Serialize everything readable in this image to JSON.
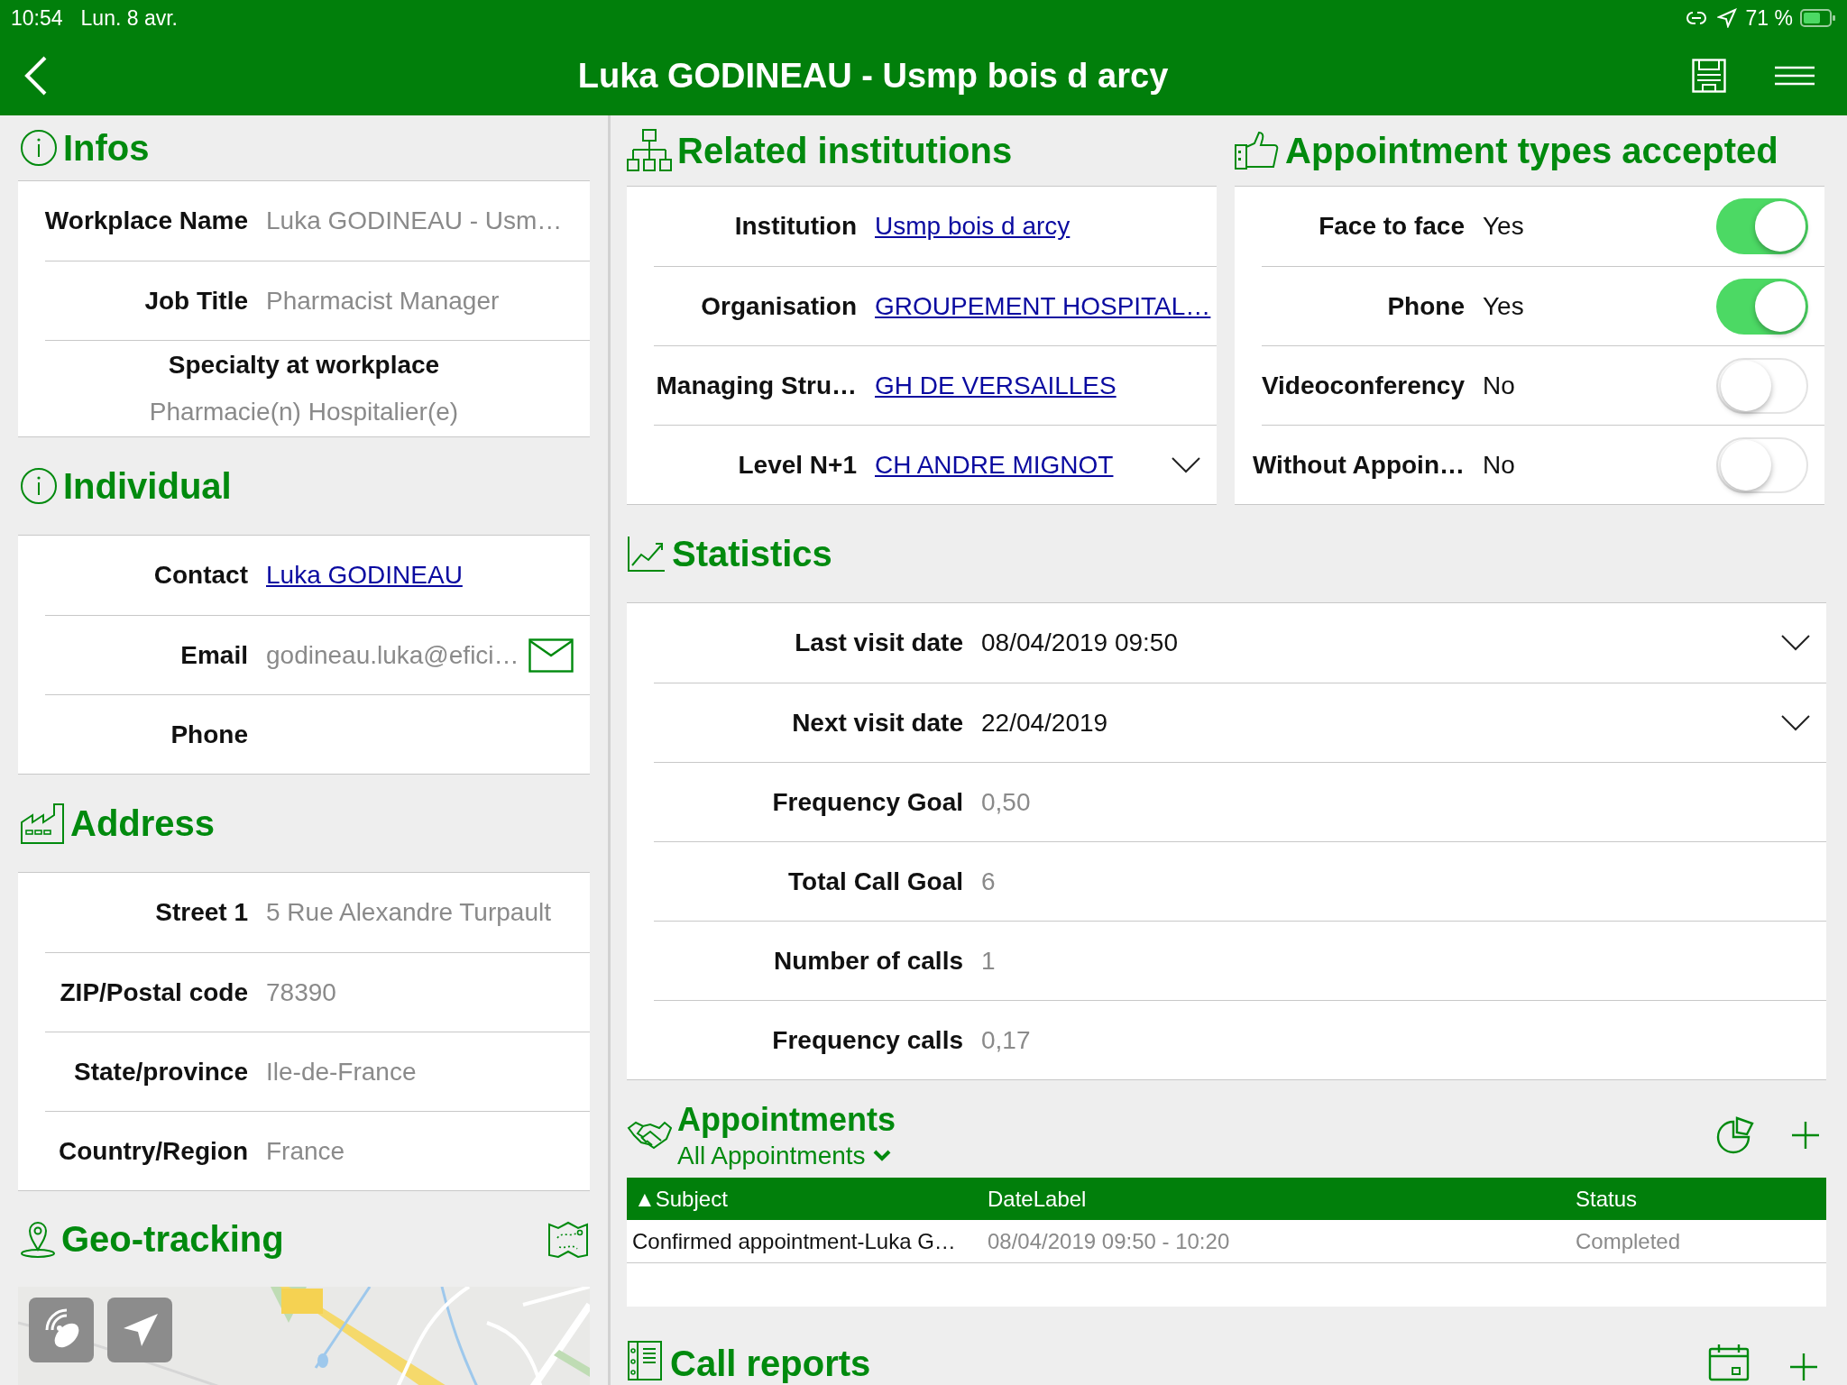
{
  "status_bar": {
    "time": "10:54",
    "date": "Lun. 8 avr.",
    "battery": "71 %"
  },
  "nav": {
    "title": "Luka GODINEAU - Usmp bois d arcy"
  },
  "infos": {
    "title": "Infos",
    "rows": [
      {
        "kind": "text",
        "label": "Workplace Name",
        "value": "Luka GODINEAU - Usm…"
      },
      {
        "kind": "text",
        "label": "Job Title",
        "value": "Pharmacist Manager"
      },
      {
        "kind": "stacked",
        "label": "Specialty at workplace",
        "value": "Pharmacie(n) Hospitalier(e)"
      }
    ]
  },
  "individual": {
    "title": "Individual",
    "rows": [
      {
        "kind": "link",
        "label": "Contact",
        "value": "Luka GODINEAU"
      },
      {
        "kind": "email",
        "label": "Email",
        "value": "godineau.luka@efici…"
      },
      {
        "kind": "text",
        "label": "Phone"
      }
    ]
  },
  "address": {
    "title": "Address",
    "rows": [
      {
        "label": "Street 1",
        "value": "5 Rue Alexandre Turpault"
      },
      {
        "label": "ZIP/Postal code",
        "value": "78390"
      },
      {
        "label": "State/province",
        "value": "Ile-de-France"
      },
      {
        "label": "Country/Region",
        "value": "France"
      }
    ]
  },
  "geo": {
    "title": "Geo-tracking"
  },
  "related": {
    "title": "Related institutions",
    "rows": [
      {
        "kind": "link",
        "label": "Institution",
        "value": "Usmp bois d arcy"
      },
      {
        "kind": "link",
        "label": "Organisation",
        "value": "GROUPEMENT HOSPITAL…"
      },
      {
        "kind": "link",
        "label": "Managing Stru…",
        "value": "GH DE VERSAILLES"
      },
      {
        "kind": "link-dropdown",
        "label": "Level N+1",
        "value": "CH ANDRE MIGNOT"
      }
    ]
  },
  "types": {
    "title": "Appointment types accepted",
    "rows": [
      {
        "label": "Face to face",
        "value": "Yes",
        "on": true
      },
      {
        "label": "Phone",
        "value": "Yes",
        "on": true
      },
      {
        "label": "Videoconferency",
        "value": "No",
        "on": false
      },
      {
        "label": "Without Appoin…",
        "value": "No",
        "on": false
      }
    ]
  },
  "statistics": {
    "title": "Statistics",
    "rows": [
      {
        "kind": "dropdown",
        "label": "Last visit date",
        "value": "08/04/2019 09:50"
      },
      {
        "kind": "dropdown",
        "label": "Next visit date",
        "value": "22/04/2019"
      },
      {
        "kind": "text",
        "label": "Frequency Goal",
        "value": "0,50"
      },
      {
        "kind": "text",
        "label": "Total Call Goal",
        "value": "6"
      },
      {
        "kind": "text",
        "label": "Number of calls",
        "value": "1"
      },
      {
        "kind": "text",
        "label": "Frequency calls",
        "value": "0,17"
      }
    ]
  },
  "appointments": {
    "title": "Appointments",
    "filter": "All Appointments",
    "columns": [
      {
        "label": "Subject",
        "sort_mark": "▲"
      },
      {
        "label": "DateLabel"
      },
      {
        "label": "Status"
      }
    ],
    "rows": [
      {
        "subject": "Confirmed appointment-Luka G…",
        "date": "08/04/2019 09:50 - 10:20",
        "status": "Completed"
      }
    ]
  },
  "call_reports": {
    "title": "Call reports"
  }
}
